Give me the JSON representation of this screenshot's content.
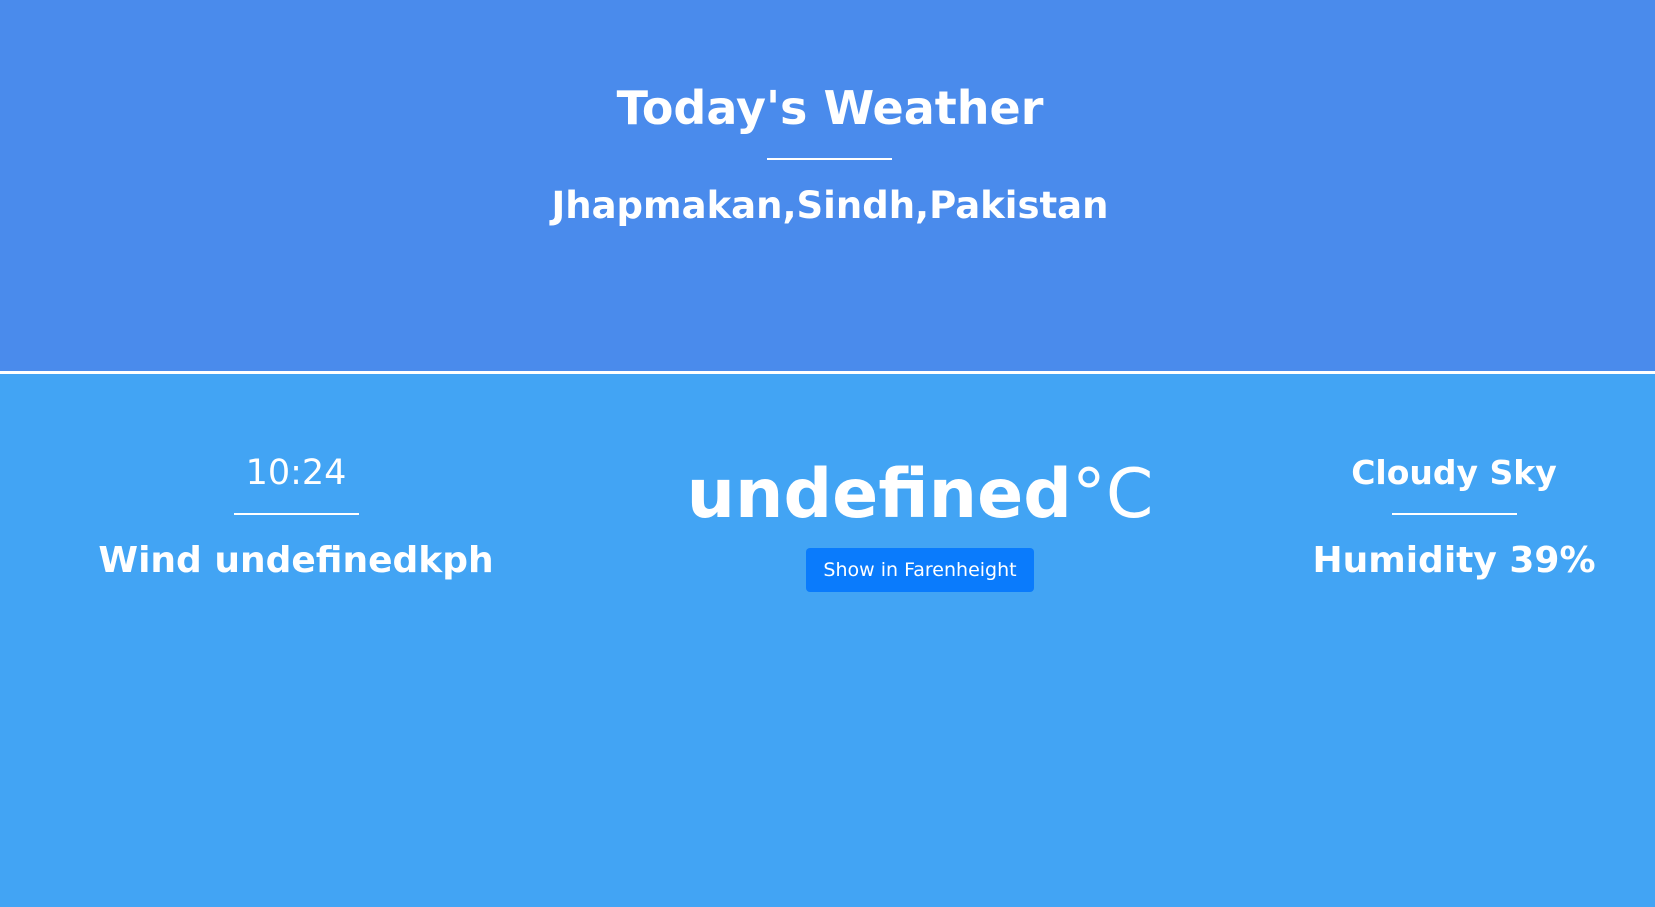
{
  "header": {
    "title": "Today's Weather",
    "location": "Jhapmakan,Sindh,Pakistan"
  },
  "left": {
    "time": "10:24",
    "wind": "Wind undefinedkph"
  },
  "center": {
    "temperature_value": "undefined",
    "temperature_unit": "°C",
    "toggle_button_label": "Show in Farenheight"
  },
  "right": {
    "condition": "Cloudy Sky",
    "humidity": "Humidity 39%"
  },
  "colors": {
    "top_background": "#4a8bec",
    "bottom_background": "#42a4f4",
    "button": "#0a7bfc",
    "text": "#ffffff"
  }
}
